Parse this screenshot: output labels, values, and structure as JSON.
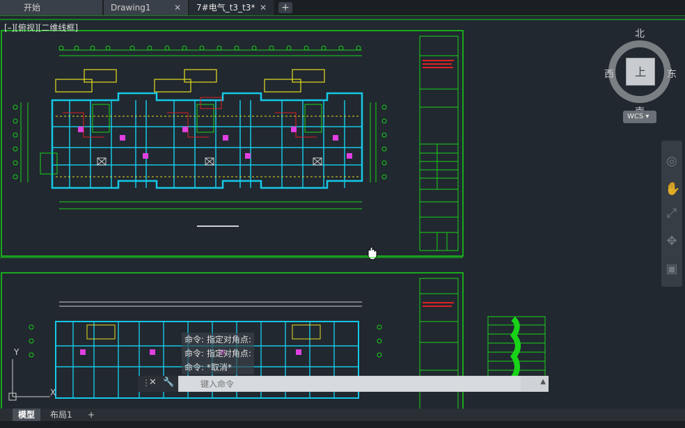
{
  "tabs": [
    {
      "label": "开始",
      "closable": false,
      "active": false
    },
    {
      "label": "Drawing1",
      "closable": true,
      "active": false
    },
    {
      "label": "7#电气_t3_t3*",
      "closable": true,
      "active": true
    }
  ],
  "tab_add_label": "+",
  "viewport": {
    "label": "[–][俯视][二维线框]"
  },
  "viewcube": {
    "face": "上",
    "north": "北",
    "south": "南",
    "east": "东",
    "west": "西"
  },
  "wcs": {
    "label": "WCS ▾"
  },
  "ucs": {
    "y_label": "Y",
    "x_label": "X"
  },
  "command": {
    "history": [
      "命令: 指定对角点:",
      "命令: 指定对角点:",
      "命令: *取消*"
    ],
    "placeholder": "键入命令"
  },
  "layout_tabs": [
    {
      "label": "模型",
      "active": true
    },
    {
      "label": "布局1",
      "active": false
    }
  ],
  "layout_add_label": "+",
  "colors": {
    "background": "#212830",
    "frame": "#19d319",
    "wall_cyan": "#16c8e6",
    "magenta": "#e040e0",
    "yellow": "#e6e020",
    "red": "#e02020"
  }
}
